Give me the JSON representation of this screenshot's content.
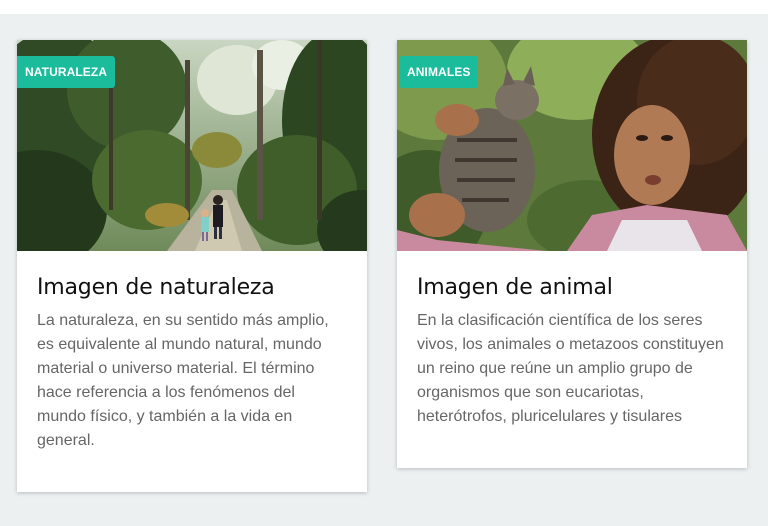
{
  "colors": {
    "page_background": "#ecf0f1",
    "card_background": "#ffffff",
    "badge_background": "#1abc9c",
    "badge_text": "#ffffff",
    "title_text": "#111111",
    "body_text": "#666666"
  },
  "cards": [
    {
      "badge": "NATURALEZA",
      "image_icon": "forest-path-photo",
      "title": "Imagen de naturaleza",
      "text": "La naturaleza, en su sentido más amplio, es equivalente al mundo natural, mundo material o universo material. El término hace referencia a los fenómenos del mundo físico, y también a la vida en general."
    },
    {
      "badge": "ANIMALES",
      "image_icon": "girl-holding-cat-photo",
      "title": "Imagen de animal",
      "text": "En la clasificación científica de los seres vivos, los animales o metazoos constituyen un reino que reúne un amplio grupo de organismos que son eucariotas, heterótrofos, pluricelulares y tisulares"
    }
  ]
}
